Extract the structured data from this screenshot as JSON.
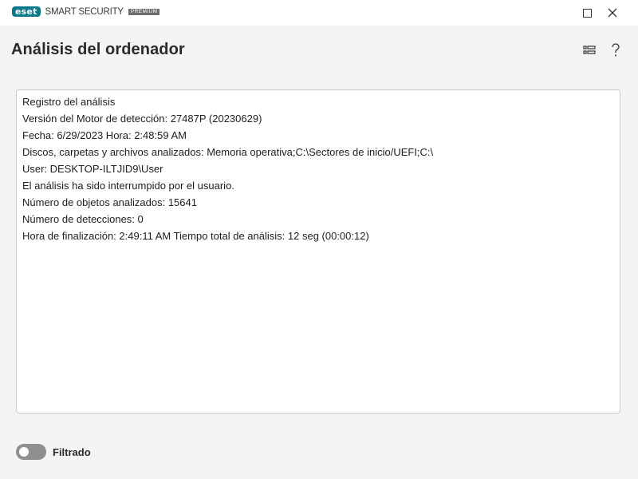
{
  "app": {
    "brand": "eset",
    "product": "SMART SECURITY",
    "edition": "PREMIUM"
  },
  "window_controls": {
    "maximize_icon": "maximize-icon",
    "close_icon": "close-icon"
  },
  "header": {
    "title": "Análisis del ordenador",
    "view_icon": "list-view-icon",
    "help_icon": "help-icon"
  },
  "log": {
    "lines": [
      "Registro del análisis",
      "Versión del Motor de detección: 27487P (20230629)",
      "Fecha: 6/29/2023  Hora: 2:48:59 AM",
      "Discos, carpetas y archivos analizados: Memoria operativa;C:\\Sectores de inicio/UEFI;C:\\",
      "User: DESKTOP-ILTJID9\\User",
      "El análisis ha sido interrumpido por el usuario.",
      "Número de objetos analizados: 15641",
      "Número de detecciones: 0",
      "Hora de finalización: 2:49:11 AM  Tiempo total de análisis: 12 seg (00:00:12)"
    ]
  },
  "footer": {
    "filter_label": "Filtrado",
    "filter_enabled": false
  },
  "colors": {
    "brand": "#0a7a8a",
    "background": "#f3f4f5",
    "panel": "#ffffff",
    "toggle_off": "#8f8f8f"
  }
}
